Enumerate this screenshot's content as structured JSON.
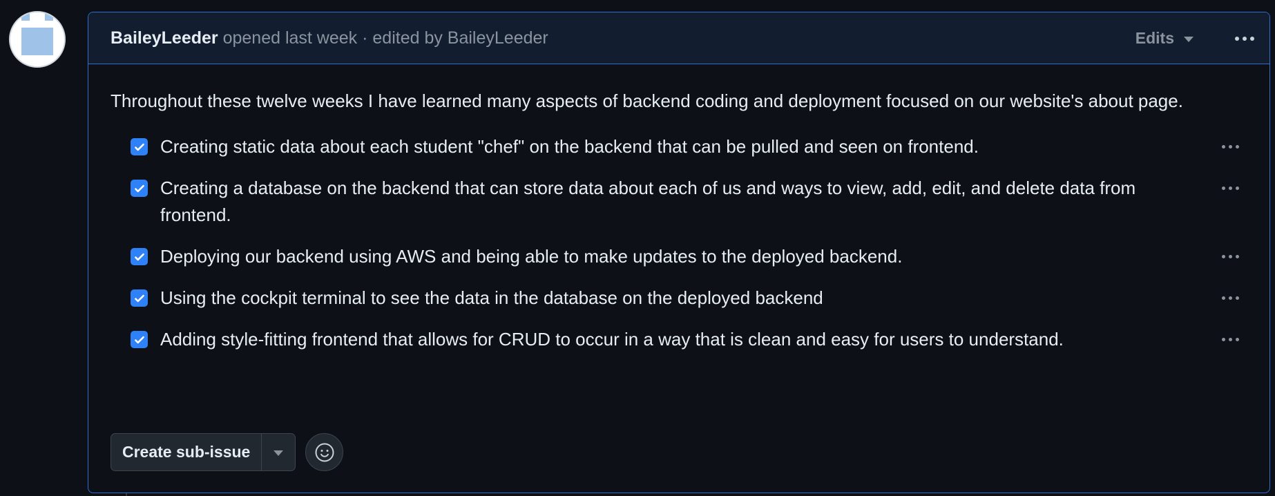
{
  "avatar_alt": "BaileyLeeder",
  "header": {
    "author": "BaileyLeeder",
    "meta": " opened last week · edited by BaileyLeeder",
    "edits_label": "Edits",
    "more_icon": "kebab-horizontal-icon"
  },
  "body": {
    "intro": "Throughout these twelve weeks I have learned many aspects of backend coding and deployment focused on our website's about page.",
    "tasks": [
      {
        "checked": true,
        "text": "Creating static data about each student \"chef\" on the backend that can be pulled and seen on frontend."
      },
      {
        "checked": true,
        "text": "Creating a database on the backend that can store data about each of us and ways to view, add, edit, and delete data from frontend."
      },
      {
        "checked": true,
        "text": "Deploying our backend using AWS and being able to make updates to the deployed backend."
      },
      {
        "checked": true,
        "text": "Using the cockpit terminal to see the data in the database on the deployed backend"
      },
      {
        "checked": true,
        "text": "Adding style-fitting frontend that allows for CRUD to occur in a way that is clean and easy for users to understand."
      }
    ]
  },
  "actions": {
    "create_sub_issue_label": "Create sub-issue",
    "emoji_icon": "smiley-icon"
  },
  "colors": {
    "background": "#0d1117",
    "header_bg": "#121d2f",
    "accent_border": "#2f6fcc",
    "checkbox": "#2f81f7",
    "muted_text": "#8b949e"
  }
}
